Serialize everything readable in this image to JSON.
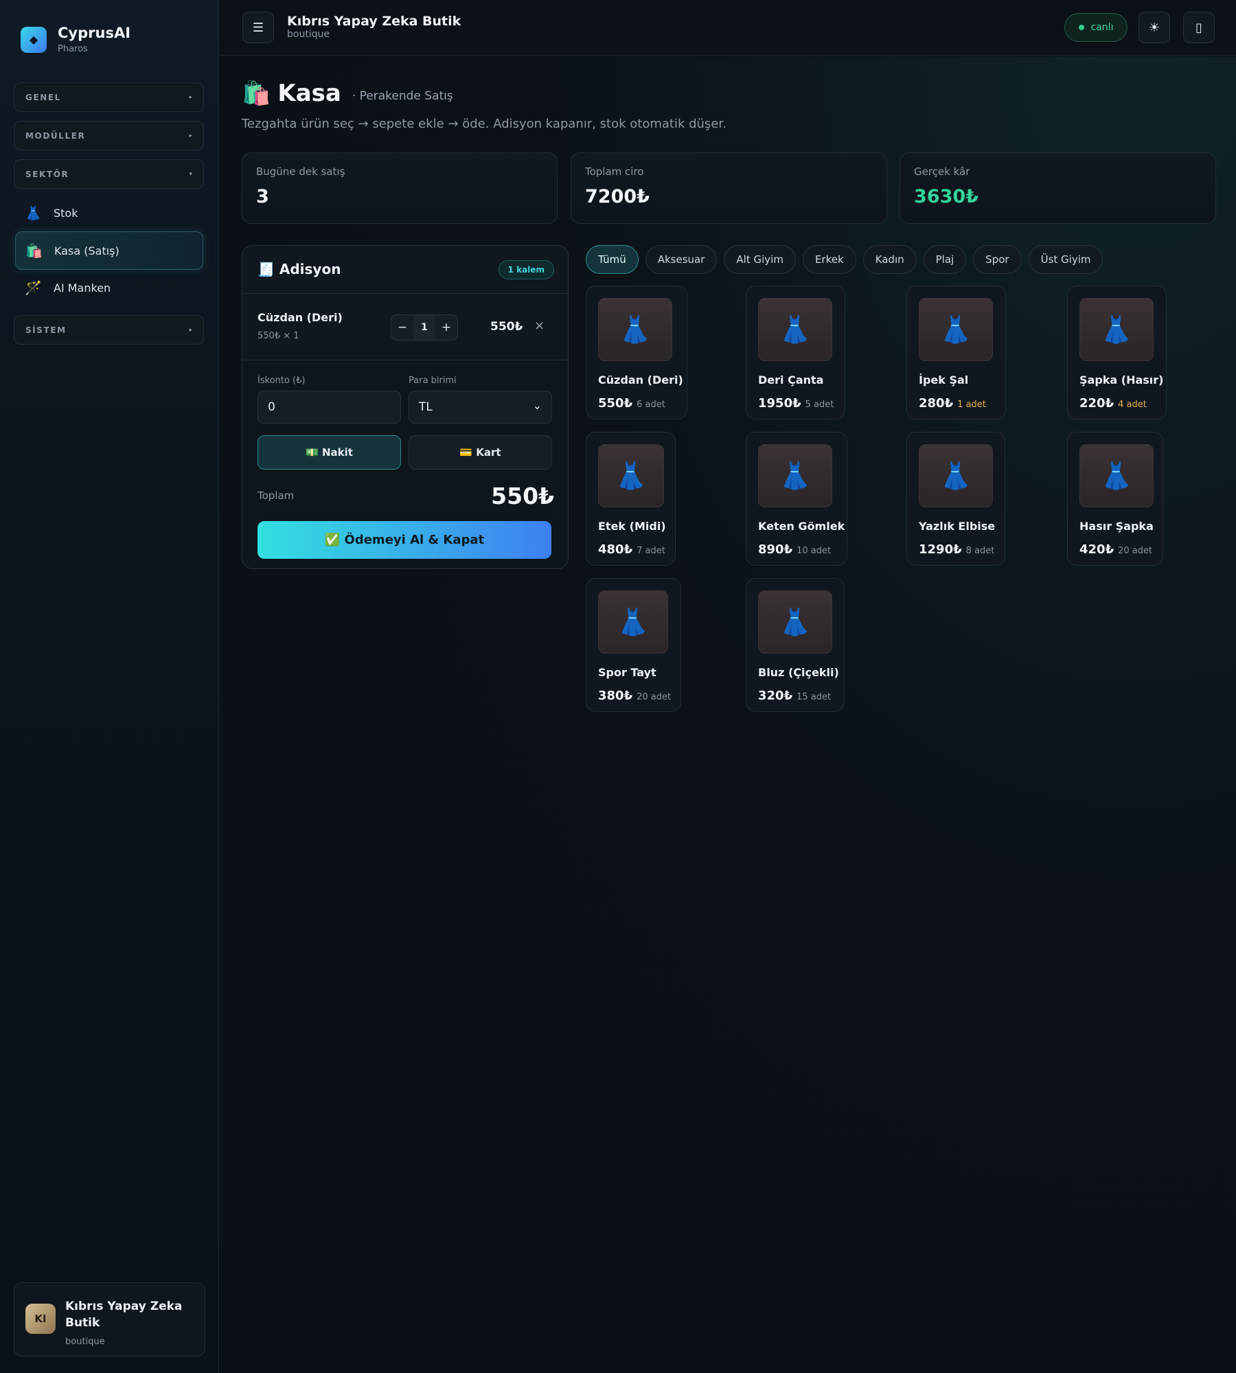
{
  "sidebar": {
    "brand": {
      "logo_glyph": "◆",
      "name": "CyprusAI",
      "sub": "Pharos"
    },
    "groups": {
      "genel": {
        "label": "GENEL",
        "chev": "▸"
      },
      "moduller": {
        "label": "MODÜLLER",
        "chev": "▸"
      },
      "sektor": {
        "label": "SEKTÖR",
        "chev": "▾"
      },
      "sistem": {
        "label": "SİSTEM",
        "chev": "▸"
      }
    },
    "items": [
      {
        "icon": "👗",
        "label": "Stok"
      },
      {
        "icon": "🛍️",
        "label": "Kasa (Satış)"
      },
      {
        "icon": "🪄",
        "label": "AI Manken"
      }
    ],
    "user": {
      "initials": "KI",
      "name": "Kıbrıs Yapay Zeka Butik",
      "sub": "boutique"
    }
  },
  "topbar": {
    "menu_icon": "☰",
    "title": "Kıbrıs Yapay Zeka Butik",
    "sub": "boutique",
    "live_label": "canlı",
    "theme_icon": "☀",
    "device_icon": "▯"
  },
  "page": {
    "emoji": "🛍️",
    "title": "Kasa",
    "crumb": "· Perakende Satış",
    "description": "Tezgahta ürün seç → sepete ekle → öde. Adisyon kapanır, stok otomatik düşer."
  },
  "stats": [
    {
      "label": "Bugüne dek satış",
      "value": "3"
    },
    {
      "label": "Toplam ciro",
      "value": "7200₺"
    },
    {
      "label": "Gerçek kâr",
      "value": "3630₺"
    }
  ],
  "adisyon": {
    "title": "🧾 Adisyon",
    "count_badge": "1 kalem",
    "item": {
      "name": "Cüzdan (Deri)",
      "sub": "550₺ × 1",
      "minus": "−",
      "qty": "1",
      "plus": "+",
      "price": "550₺",
      "remove": "×"
    },
    "discount_label": "İskonto (₺)",
    "discount_value": "0",
    "currency_label": "Para birimi",
    "currency_value": "TL",
    "select_chev": "⌄",
    "cash_label": "💵 Nakit",
    "card_label": "💳 Kart",
    "total_label": "Toplam",
    "total_value": "550₺",
    "checkout_label": "✅ Ödemeyi Al & Kapat"
  },
  "filters": [
    "Tümü",
    "Aksesuar",
    "Alt Giyim",
    "Erkek",
    "Kadın",
    "Plaj",
    "Spor",
    "Üst Giyim"
  ],
  "products": [
    {
      "icon": "👗",
      "name": "Cüzdan (Deri)",
      "price": "550₺",
      "stock": "6 adet",
      "low": false
    },
    {
      "icon": "👗",
      "name": "Deri Çanta",
      "price": "1950₺",
      "stock": "5 adet",
      "low": false
    },
    {
      "icon": "👗",
      "name": "İpek Şal",
      "price": "280₺",
      "stock": "1 adet",
      "low": true
    },
    {
      "icon": "👗",
      "name": "Şapka (Hasır)",
      "price": "220₺",
      "stock": "4 adet",
      "low": true
    },
    {
      "icon": "👗",
      "name": "Etek (Midi)",
      "price": "480₺",
      "stock": "7 adet",
      "low": false
    },
    {
      "icon": "👗",
      "name": "Keten Gömlek",
      "price": "890₺",
      "stock": "10 adet",
      "low": false
    },
    {
      "icon": "👗",
      "name": "Yazlık Elbise",
      "price": "1290₺",
      "stock": "8 adet",
      "low": false
    },
    {
      "icon": "👗",
      "name": "Hasır Şapka",
      "price": "420₺",
      "stock": "20 adet",
      "low": false
    },
    {
      "icon": "👗",
      "name": "Spor Tayt",
      "price": "380₺",
      "stock": "20 adet",
      "low": false
    },
    {
      "icon": "👗",
      "name": "Bluz (Çiçekli)",
      "price": "320₺",
      "stock": "15 adet",
      "low": false
    }
  ]
}
